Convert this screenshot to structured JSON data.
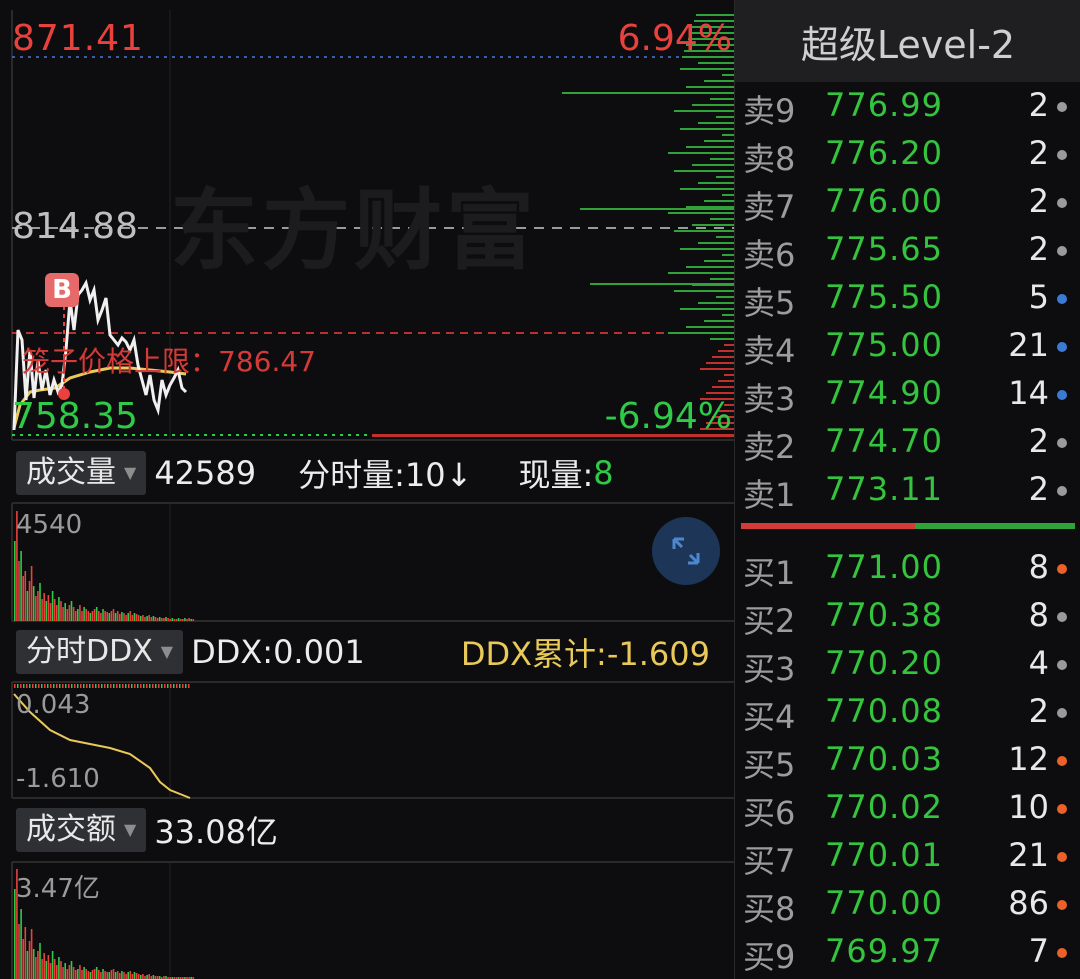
{
  "chart": {
    "price_high": "871.41",
    "pct_high": "6.94%",
    "price_base": "814.88",
    "price_low": "758.35",
    "pct_low": "-6.94%",
    "limit_label": "笼子价格上限：",
    "limit_value": "786.47",
    "watermark": "东方财富",
    "b_marker": "B"
  },
  "volume_bar": {
    "dropdown_label": "成交量",
    "volume": "42589",
    "interval_label": "分时量:10↓",
    "current_label": "现量:",
    "current_value": "8",
    "axis_max": "4540"
  },
  "ddx_bar": {
    "dropdown_label": "分时DDX",
    "ddx_label": "DDX:0.001",
    "ddx_cum_label": "DDX累计:-1.609",
    "axis_max": "0.043",
    "axis_min": "-1.610"
  },
  "amount_bar": {
    "dropdown_label": "成交额",
    "amount": "33.08亿",
    "axis_max": "3.47亿"
  },
  "order_book": {
    "title": "超级Level-2",
    "asks": [
      {
        "name": "卖9",
        "price": "776.99",
        "vol": "2",
        "dot": "#9a9a9a"
      },
      {
        "name": "卖8",
        "price": "776.20",
        "vol": "2",
        "dot": "#9a9a9a"
      },
      {
        "name": "卖7",
        "price": "776.00",
        "vol": "2",
        "dot": "#9a9a9a"
      },
      {
        "name": "卖6",
        "price": "775.65",
        "vol": "2",
        "dot": "#9a9a9a"
      },
      {
        "name": "卖5",
        "price": "775.50",
        "vol": "5",
        "dot": "#3b7bd6"
      },
      {
        "name": "卖4",
        "price": "775.00",
        "vol": "21",
        "dot": "#3b7bd6"
      },
      {
        "name": "卖3",
        "price": "774.90",
        "vol": "14",
        "dot": "#3b7bd6"
      },
      {
        "name": "卖2",
        "price": "774.70",
        "vol": "2",
        "dot": "#9a9a9a"
      },
      {
        "name": "卖1",
        "price": "773.11",
        "vol": "2",
        "dot": "#9a9a9a"
      }
    ],
    "bids": [
      {
        "name": "买1",
        "price": "771.00",
        "vol": "8",
        "dot": "#e8622a"
      },
      {
        "name": "买2",
        "price": "770.38",
        "vol": "8",
        "dot": "#9a9a9a"
      },
      {
        "name": "买3",
        "price": "770.20",
        "vol": "4",
        "dot": "#9a9a9a"
      },
      {
        "name": "买4",
        "price": "770.08",
        "vol": "2",
        "dot": "#9a9a9a"
      },
      {
        "name": "买5",
        "price": "770.03",
        "vol": "12",
        "dot": "#e8622a"
      },
      {
        "name": "买6",
        "price": "770.02",
        "vol": "10",
        "dot": "#e8622a"
      },
      {
        "name": "买7",
        "price": "770.01",
        "vol": "21",
        "dot": "#e8622a"
      },
      {
        "name": "买8",
        "price": "770.00",
        "vol": "86",
        "dot": "#e8622a"
      },
      {
        "name": "买9",
        "price": "769.97",
        "vol": "7",
        "dot": "#e8622a"
      }
    ],
    "buy_sell_ratio": 0.52
  },
  "colors": {
    "up": "#e8413e",
    "down": "#2fca47",
    "avg_line": "#e8c95a",
    "price_line": "#f0f0f0"
  }
}
